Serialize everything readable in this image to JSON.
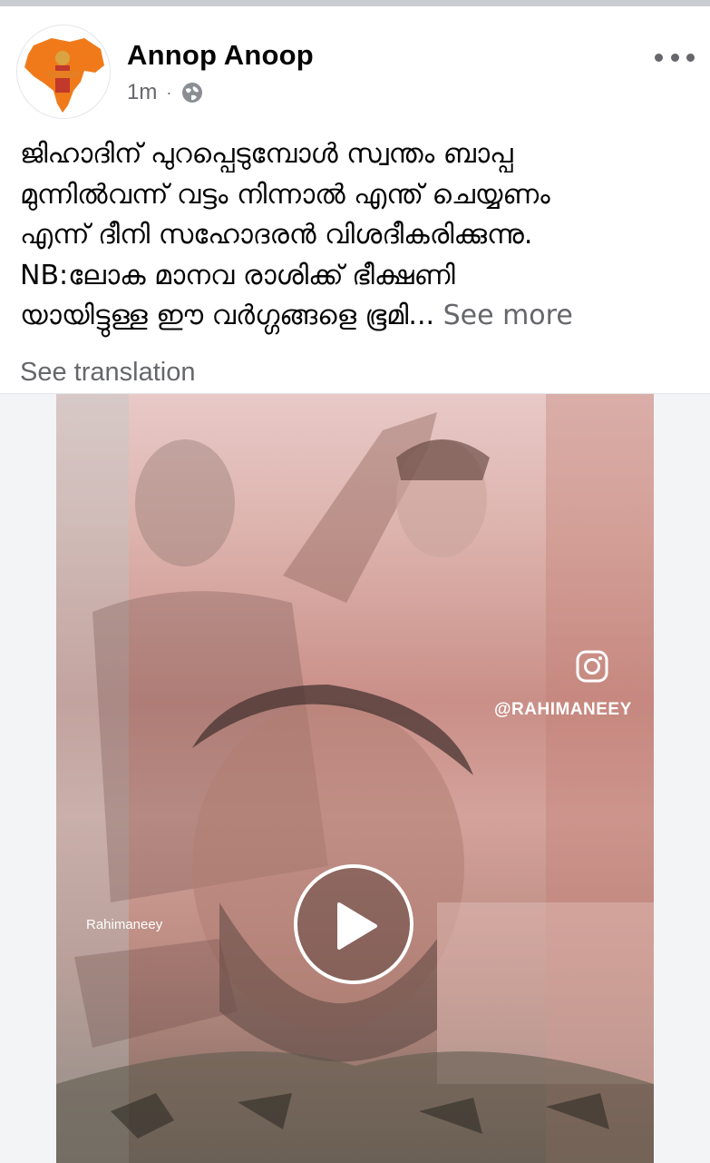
{
  "post": {
    "author": "Annop Anoop",
    "timestamp": "1m",
    "privacy_icon": "globe-icon",
    "text_lines": [
      "ജിഹാദിന് പുറപ്പെടുമ്പോൾ സ്വന്തം ബാപ്പ",
      "മുന്നിൽവന്ന് വട്ടം നിന്നാൽ എന്ത് ചെയ്യണം",
      "എന്ന് ദീനി സഹോദരൻ വിശദീകരിക്കുന്നു.",
      "NB:ലോക മാനവ രാശിക്ക് ഭീക്ഷണി",
      "യായിട്ടുള്ള ഈ വർഗ്ഗങ്ങളെ ഭൂമി..."
    ],
    "see_more": "See more",
    "see_translation": "See translation"
  },
  "video": {
    "instagram_handle": "@RAHIMANEEY",
    "watermark": "Rahimaneey",
    "play_icon": "play-icon"
  },
  "colors": {
    "text_primary": "#050505",
    "text_secondary": "#65676b",
    "avatar_accent": "#f07a1a"
  }
}
